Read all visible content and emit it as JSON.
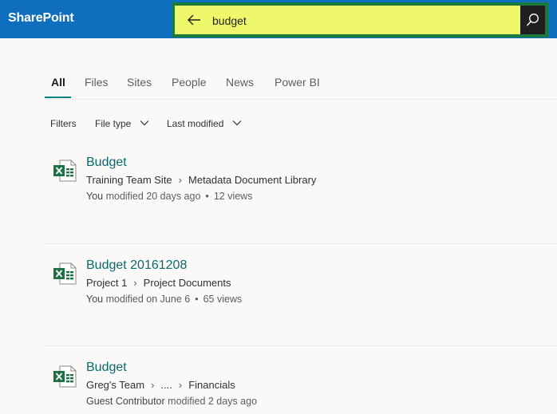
{
  "app": {
    "brand": "SharePoint"
  },
  "search": {
    "query": "budget"
  },
  "tabs": [
    {
      "label": "All",
      "active": true
    },
    {
      "label": "Files"
    },
    {
      "label": "Sites"
    },
    {
      "label": "People"
    },
    {
      "label": "News"
    },
    {
      "label": "Power BI"
    }
  ],
  "filters": {
    "label": "Filters",
    "file_type": "File type",
    "last_modified": "Last modified"
  },
  "results": [
    {
      "title": "Budget",
      "path": [
        "Training Team Site",
        "Metadata Document Library"
      ],
      "who": "You",
      "modified": "modified 20 days ago",
      "views": "12 views"
    },
    {
      "title": "Budget 20161208",
      "path": [
        "Project 1",
        "Project Documents"
      ],
      "who": "You",
      "modified": "modified on June 6",
      "views": "65 views"
    },
    {
      "title": "Budget",
      "path": [
        "Greg's Team",
        "....",
        "Financials"
      ],
      "who": "Guest Contributor",
      "modified": "modified 2 days ago"
    }
  ],
  "colors": {
    "topbar": "#106ebe",
    "search_highlight": "#eef86a",
    "search_border": "#1b7a3d",
    "accent": "#038387",
    "excel_green": "#1e7145"
  }
}
